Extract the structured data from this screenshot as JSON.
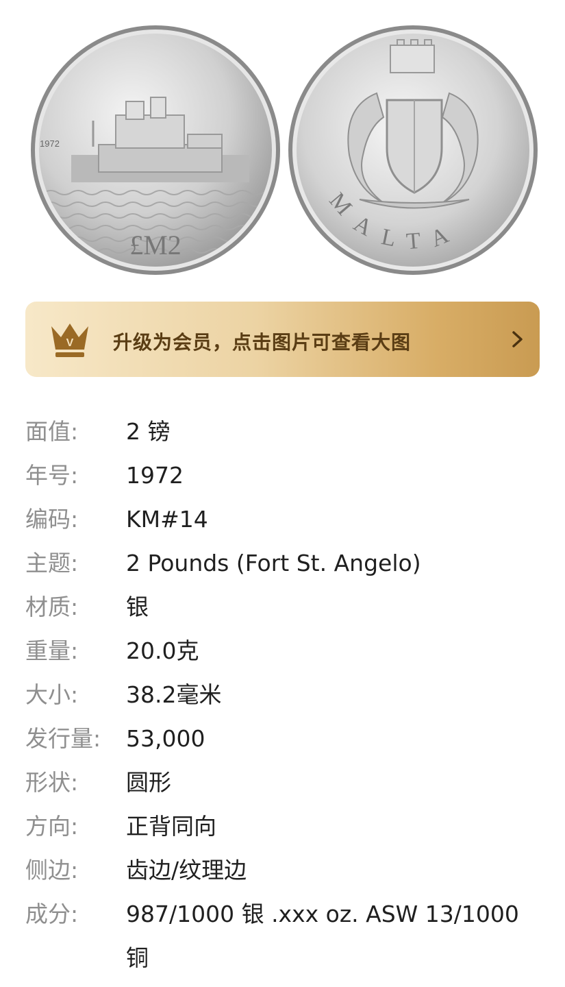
{
  "coin_images": {
    "obverse": {
      "year": "1972",
      "denomination": "£M2"
    },
    "reverse": {
      "country": "MALTA"
    }
  },
  "banner": {
    "crown_letter": "V",
    "text": "升级为会员，点击图片可查看大图",
    "colors": {
      "start": "#f7e8c8",
      "end": "#c99b52",
      "text": "#5a3d14",
      "icon": "#8a5d1e"
    }
  },
  "specs": [
    {
      "label": "面值:",
      "value": "2 镑"
    },
    {
      "label": "年号:",
      "value": "1972"
    },
    {
      "label": "编码:",
      "value": "KM#14"
    },
    {
      "label": "主题:",
      "value": "2 Pounds (Fort St. Angelo)"
    },
    {
      "label": "材质:",
      "value": "银"
    },
    {
      "label": "重量:",
      "value": "20.0克"
    },
    {
      "label": "大小:",
      "value": "38.2毫米"
    },
    {
      "label": "发行量:",
      "value": "53,000"
    },
    {
      "label": "形状:",
      "value": "圆形"
    },
    {
      "label": "方向:",
      "value": "正背同向"
    },
    {
      "label": "侧边:",
      "value": "齿边/纹理边"
    },
    {
      "label": "成分:",
      "value": "987/1000 银 .xxx oz. ASW 13/1000 铜"
    }
  ]
}
